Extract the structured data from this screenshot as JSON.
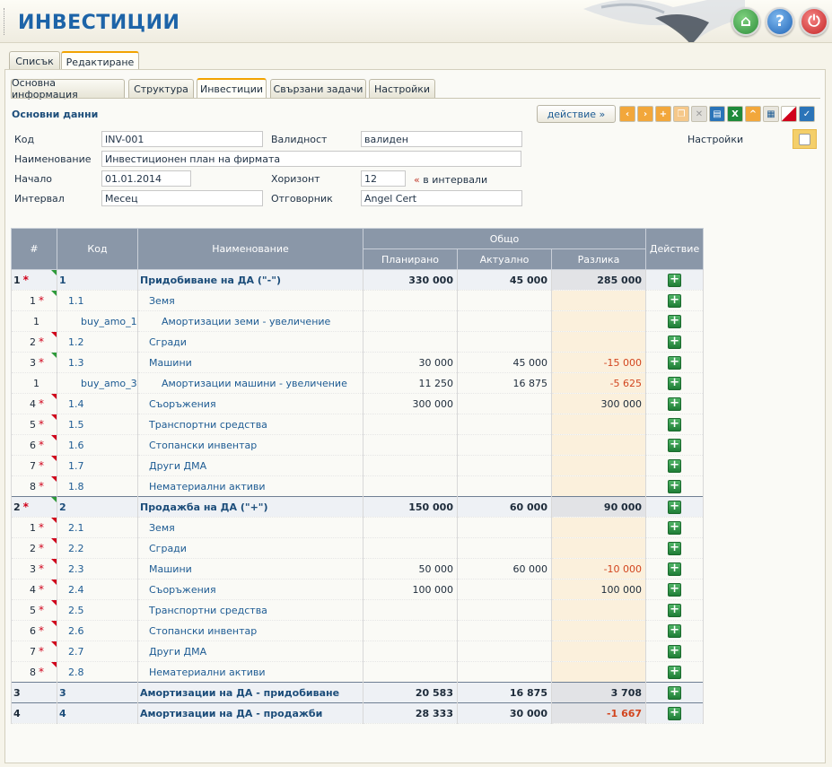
{
  "app": {
    "title": "ИНВЕСТИЦИИ"
  },
  "top_tabs": [
    "Списък",
    "Редактиране"
  ],
  "sub_tabs": [
    "Основна информация",
    "Структура",
    "Инвестиции",
    "Свързани задачи",
    "Настройки"
  ],
  "section_title": "Основни данни",
  "actions_label": "действие »",
  "toolbar_icons": [
    "arrow-left-icon",
    "arrow-right-icon",
    "add-icon",
    "copy-icon",
    "delete-icon",
    "print-icon",
    "excel-icon",
    "collapse-icon",
    "calculator-icon",
    "flag-icon",
    "check-icon"
  ],
  "form": {
    "code_label": "Код",
    "code_value": "INV-001",
    "validity_label": "Валидност",
    "validity_value": "валиден",
    "settings_label": "Настройки",
    "name_label": "Наименование",
    "name_value": "Инвестиционен план на фирмата",
    "start_label": "Начало",
    "start_value": "01.01.2014",
    "horizon_label": "Хоризонт",
    "horizon_value": "12",
    "horizon_note": "в интервали",
    "interval_label": "Интервал",
    "interval_value": "Месец",
    "owner_label": "Отговорник",
    "owner_value": "Angel Cert"
  },
  "table": {
    "headers": {
      "idx": "#",
      "code": "Код",
      "name": "Наименование",
      "total": "Общо",
      "planned": "Планирано",
      "actual": "Актуално",
      "diff": "Разлика",
      "action": "Действие"
    },
    "rows": [
      {
        "type": "group",
        "idx": "1",
        "star": "*",
        "mark": "green",
        "code": "1",
        "name": "Придобиване на ДА (\"-\")",
        "planned": "330 000",
        "actual": "45 000",
        "diff": "285 000",
        "neg": false
      },
      {
        "type": "item",
        "idx": "1",
        "star": "*",
        "mark": "green",
        "code": "1.1",
        "name": "Земя",
        "planned": "",
        "actual": "",
        "diff": "",
        "neg": false
      },
      {
        "type": "sub",
        "idx": "1",
        "star": "",
        "mark": "",
        "code": "buy_amo_1",
        "name": "Амортизации земи - увеличение",
        "planned": "",
        "actual": "",
        "diff": "",
        "neg": false
      },
      {
        "type": "item",
        "idx": "2",
        "star": "*",
        "mark": "red",
        "code": "1.2",
        "name": "Сгради",
        "planned": "",
        "actual": "",
        "diff": "",
        "neg": false
      },
      {
        "type": "item",
        "idx": "3",
        "star": "*",
        "mark": "green",
        "code": "1.3",
        "name": "Машини",
        "planned": "30 000",
        "actual": "45 000",
        "diff": "-15 000",
        "neg": true
      },
      {
        "type": "sub",
        "idx": "1",
        "star": "",
        "mark": "",
        "code": "buy_amo_3",
        "name": "Амортизации машини - увеличение",
        "planned": "11 250",
        "actual": "16 875",
        "diff": "-5 625",
        "neg": true
      },
      {
        "type": "item",
        "idx": "4",
        "star": "*",
        "mark": "red",
        "code": "1.4",
        "name": "Съоръжения",
        "planned": "300 000",
        "actual": "",
        "diff": "300 000",
        "neg": false
      },
      {
        "type": "item",
        "idx": "5",
        "star": "*",
        "mark": "red",
        "code": "1.5",
        "name": "Транспортни средства",
        "planned": "",
        "actual": "",
        "diff": "",
        "neg": false
      },
      {
        "type": "item",
        "idx": "6",
        "star": "*",
        "mark": "red",
        "code": "1.6",
        "name": "Стопански инвентар",
        "planned": "",
        "actual": "",
        "diff": "",
        "neg": false
      },
      {
        "type": "item",
        "idx": "7",
        "star": "*",
        "mark": "red",
        "code": "1.7",
        "name": "Други ДМА",
        "planned": "",
        "actual": "",
        "diff": "",
        "neg": false
      },
      {
        "type": "item",
        "idx": "8",
        "star": "*",
        "mark": "red",
        "code": "1.8",
        "name": "Нематериални активи",
        "planned": "",
        "actual": "",
        "diff": "",
        "neg": false
      },
      {
        "type": "group",
        "idx": "2",
        "star": "*",
        "mark": "green",
        "code": "2",
        "name": "Продажба на ДА (\"+\")",
        "planned": "150 000",
        "actual": "60 000",
        "diff": "90 000",
        "neg": false
      },
      {
        "type": "item",
        "idx": "1",
        "star": "*",
        "mark": "red",
        "code": "2.1",
        "name": "Земя",
        "planned": "",
        "actual": "",
        "diff": "",
        "neg": false
      },
      {
        "type": "item",
        "idx": "2",
        "star": "*",
        "mark": "red",
        "code": "2.2",
        "name": "Сгради",
        "planned": "",
        "actual": "",
        "diff": "",
        "neg": false
      },
      {
        "type": "item",
        "idx": "3",
        "star": "*",
        "mark": "red",
        "code": "2.3",
        "name": "Машини",
        "planned": "50 000",
        "actual": "60 000",
        "diff": "-10 000",
        "neg": true
      },
      {
        "type": "item",
        "idx": "4",
        "star": "*",
        "mark": "red",
        "code": "2.4",
        "name": "Съоръжения",
        "planned": "100 000",
        "actual": "",
        "diff": "100 000",
        "neg": false
      },
      {
        "type": "item",
        "idx": "5",
        "star": "*",
        "mark": "red",
        "code": "2.5",
        "name": "Транспортни средства",
        "planned": "",
        "actual": "",
        "diff": "",
        "neg": false
      },
      {
        "type": "item",
        "idx": "6",
        "star": "*",
        "mark": "red",
        "code": "2.6",
        "name": "Стопански инвентар",
        "planned": "",
        "actual": "",
        "diff": "",
        "neg": false
      },
      {
        "type": "item",
        "idx": "7",
        "star": "*",
        "mark": "red",
        "code": "2.7",
        "name": "Други ДМА",
        "planned": "",
        "actual": "",
        "diff": "",
        "neg": false
      },
      {
        "type": "item",
        "idx": "8",
        "star": "*",
        "mark": "red",
        "code": "2.8",
        "name": "Нематериални активи",
        "planned": "",
        "actual": "",
        "diff": "",
        "neg": false
      },
      {
        "type": "group",
        "idx": "3",
        "star": "",
        "mark": "",
        "code": "3",
        "name": "Амортизации на ДА - придобиване",
        "planned": "20 583",
        "actual": "16 875",
        "diff": "3 708",
        "neg": false
      },
      {
        "type": "group",
        "idx": "4",
        "star": "",
        "mark": "",
        "code": "4",
        "name": "Амортизации на ДА - продажби",
        "planned": "28 333",
        "actual": "30 000",
        "diff": "-1 667",
        "neg": true
      }
    ]
  },
  "colors": {
    "accent": "#1d64a8",
    "header_bg": "#8a97a8",
    "diff_bg": "#fbf0dc",
    "negative": "#d2451e",
    "plus_green": "#2f8f3c"
  }
}
